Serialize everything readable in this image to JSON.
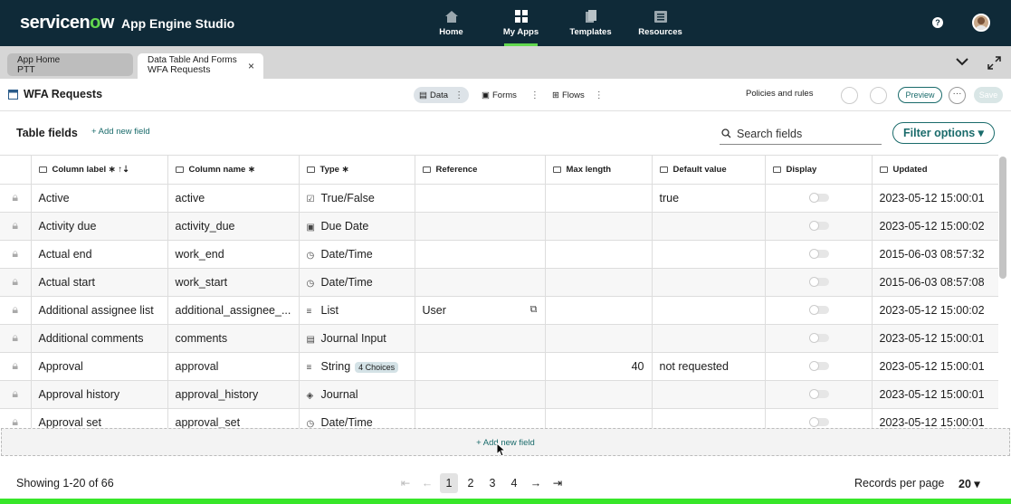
{
  "brand": {
    "logo_a": "servicen",
    "logo_o": "o",
    "logo_b": "w",
    "app": "App Engine Studio"
  },
  "nav": [
    {
      "label": "Home",
      "icon": "home-icon"
    },
    {
      "label": "My Apps",
      "icon": "grid-icon",
      "active": true
    },
    {
      "label": "Templates",
      "icon": "templates-icon"
    },
    {
      "label": "Resources",
      "icon": "resources-icon"
    }
  ],
  "help": "?",
  "tabs": [
    {
      "title": "App Home",
      "sub": "PTT"
    },
    {
      "title": "Data Table And Forms",
      "sub": "WFA Requests",
      "close": "×"
    }
  ],
  "toolbar": {
    "title": "WFA Requests",
    "data": "Data",
    "forms": "Forms",
    "flows": "Flows",
    "policies": "Policies and rules",
    "preview": "Preview",
    "more": "···",
    "save": "Save"
  },
  "section": {
    "title": "Table fields",
    "add": "+  Add new field",
    "search_placeholder": "Search fields",
    "filter": "Filter options ▾"
  },
  "columns": [
    "Column label ∗ ↑⇣",
    "Column name ∗",
    "Type ∗",
    "Reference",
    "Max length",
    "Default value",
    "Display",
    "Updated"
  ],
  "rows": [
    {
      "label": "Active",
      "name": "active",
      "type": "True/False",
      "ticon": "☑",
      "ref": "",
      "max": "",
      "default": "true",
      "updated": "2023-05-12 15:00:01"
    },
    {
      "label": "Activity due",
      "name": "activity_due",
      "type": "Due Date",
      "ticon": "▣",
      "ref": "",
      "max": "",
      "default": "",
      "updated": "2023-05-12 15:00:02"
    },
    {
      "label": "Actual end",
      "name": "work_end",
      "type": "Date/Time",
      "ticon": "◷",
      "ref": "",
      "max": "",
      "default": "",
      "updated": "2015-06-03 08:57:32"
    },
    {
      "label": "Actual start",
      "name": "work_start",
      "type": "Date/Time",
      "ticon": "◷",
      "ref": "",
      "max": "",
      "default": "",
      "updated": "2015-06-03 08:57:08"
    },
    {
      "label": "Additional assignee list",
      "name": "additional_assignee_...",
      "type": "List",
      "ticon": "≡",
      "ref": "User",
      "max": "",
      "default": "",
      "updated": "2023-05-12 15:00:02"
    },
    {
      "label": "Additional comments",
      "name": "comments",
      "type": "Journal Input",
      "ticon": "▤",
      "ref": "",
      "max": "",
      "default": "",
      "updated": "2023-05-12 15:00:01"
    },
    {
      "label": "Approval",
      "name": "approval",
      "type": "String",
      "ticon": "≡",
      "badge": "4 Choices",
      "ref": "",
      "max": "40",
      "default": "not requested",
      "updated": "2023-05-12 15:00:01"
    },
    {
      "label": "Approval history",
      "name": "approval_history",
      "type": "Journal",
      "ticon": "◈",
      "ref": "",
      "max": "",
      "default": "",
      "updated": "2023-05-12 15:00:01"
    },
    {
      "label": "Approval set",
      "name": "approval_set",
      "type": "Date/Time",
      "ticon": "◷",
      "ref": "",
      "max": "",
      "default": "",
      "updated": "2023-05-12 15:00:01"
    }
  ],
  "add_row": "+   Add new field",
  "footer": {
    "showing": "Showing 1-20 of 66",
    "pages": [
      "1",
      "2",
      "3",
      "4"
    ],
    "first": "⇤",
    "prev": "←",
    "next": "→",
    "last": "⇥",
    "rpp_label": "Records per page",
    "rpp_value": "20 ▾"
  },
  "colors": {
    "topbar": "#0f2a38",
    "accent": "#62d84e",
    "teal": "#1a6b6b"
  }
}
